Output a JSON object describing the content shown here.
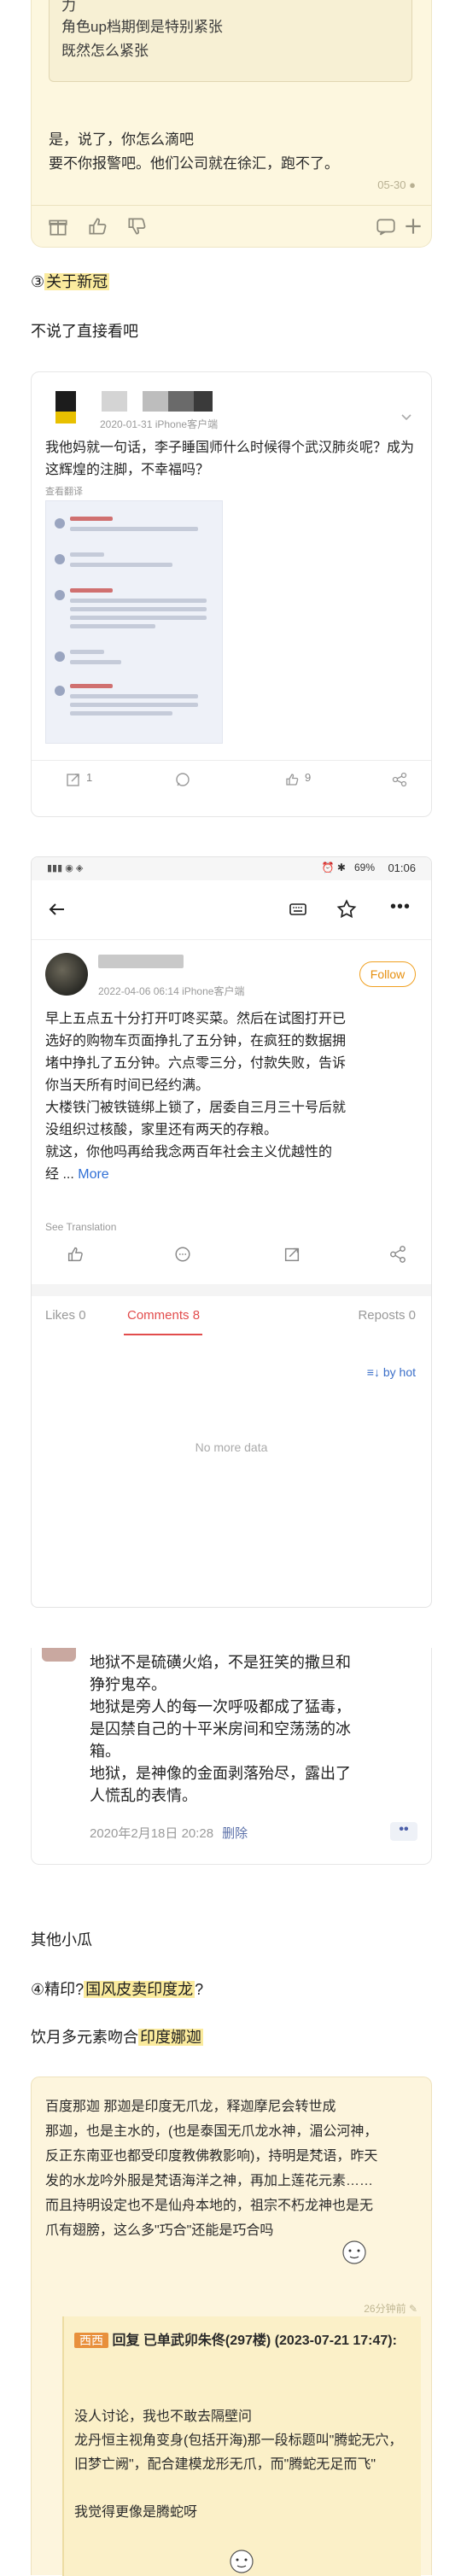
{
  "card1": {
    "quote_lines": [
      "力",
      "角色up档期倒是特别紧张",
      "既然怎么紧张"
    ],
    "body_lines": [
      "是，说了，你怎么滴吧",
      "要不你报警吧。他们公司就在徐汇，跑不了。"
    ],
    "time": "05-30",
    "icons": [
      "gift-icon",
      "thumbs-up-icon",
      "thumbs-down-icon",
      "comment-icon",
      "plus-icon"
    ]
  },
  "section_covid": {
    "num": "③",
    "title": "关于新冠"
  },
  "intro_text": "不说了直接看吧",
  "card2": {
    "meta": "2020-01-31   iPhone客户端",
    "text": "我他妈就一句话，李子睡国师什么时候得个武汉肺炎呢？成为这辉煌的注脚，不幸福吗？",
    "translate": "查看翻译",
    "actions": {
      "repost": "1",
      "like": "9"
    }
  },
  "card3": {
    "status_battery": "69%",
    "status_time": "01:06",
    "meta": "2022-04-06 06:14   iPhone客户端",
    "follow": "Follow",
    "text_lines": [
      "早上五点五十分打开叮咚买菜。然后在试图打开已",
      "选好的购物车页面挣扎了五分钟，在疯狂的数据拥",
      "堵中挣扎了五分钟。六点零三分，付款失败，告诉",
      "你当天所有时间已经约满。",
      "大楼铁门被铁链绑上锁了，居委自三月三十号后就",
      "没组织过核酸，家里还有两天的存粮。",
      "就这，你他吗再给我念两百年社会主义优越性的"
    ],
    "text_tail": "经 ...",
    "more": "More",
    "translate": "See Translation",
    "tabs": {
      "likes": "Likes",
      "likes_count": "0",
      "comments": "Comments",
      "comments_count": "8",
      "reposts": "Reposts",
      "reposts_count": "0"
    },
    "sort": "by hot",
    "no_more": "No more data"
  },
  "card4": {
    "text_lines": [
      "地狱不是硫磺火焰，不是狂笑的撒旦和",
      "狰狞鬼卒。",
      "地狱是旁人的每一次呼吸都成了猛毒，",
      "是囚禁自己的十平米房间和空荡荡的冰",
      "箱。",
      "地狱，是神像的金面剥落殆尽，露出了",
      "人慌乱的表情。"
    ],
    "time": "2020年2月18日 20:28",
    "delete": "删除",
    "more": "••"
  },
  "other_melon": "其他小瓜",
  "section_print": {
    "num": "④",
    "pre": "精印?",
    "hl": "国风皮卖印度龙",
    "post": "?"
  },
  "drink_text": {
    "pre": "饮月多元素吻合",
    "hl": "印度娜迦"
  },
  "card5": {
    "text_lines": [
      "百度那迦 那迦是印度无爪龙，释迦摩尼会转世成",
      "那迦，也是主水的，(也是泰国无爪龙水神，湄公河神，",
      "反正东南亚也都受印度教佛教影响)，持明是梵语，昨天",
      "发的水龙吟外服是梵语海洋之神，再加上莲花元素……",
      "而且持明设定也不是仙舟本地的，祖宗不朽龙神也是无",
      "爪有翅膀，这么多\"巧合\"还能是巧合吗"
    ],
    "time": "26分钟前",
    "quote_tag": "西西",
    "quote_head": "回复 已单武卯朱佟(297楼) (2023-07-21 17:47):",
    "quote_lines": [
      "没人讨论，我也不敢去隔壁问",
      "龙丹恒主视角变身(包括开海)那一段标题叫\"腾蛇无穴，旧梦亡阙\"，配合建模龙形无爪，而\"腾蛇无足而飞\"",
      "",
      "我觉得更像是腾蛇呀"
    ]
  }
}
